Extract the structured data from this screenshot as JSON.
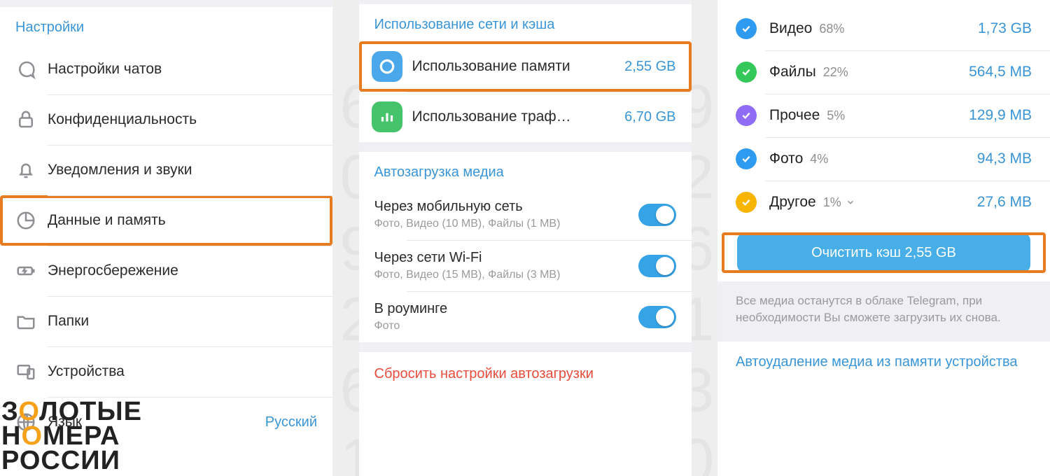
{
  "panel1": {
    "header": "Настройки",
    "items": [
      {
        "label": "Настройки чатов"
      },
      {
        "label": "Конфиденциальность"
      },
      {
        "label": "Уведомления и звуки"
      },
      {
        "label": "Данные и память",
        "highlighted": true
      },
      {
        "label": "Энергосбережение"
      },
      {
        "label": "Папки"
      },
      {
        "label": "Устройства"
      },
      {
        "label": "Язык",
        "value": "Русский"
      }
    ]
  },
  "panel2": {
    "section_usage": "Использование сети и кэша",
    "storage_label": "Использование памяти",
    "storage_value": "2,55 GB",
    "traffic_label": "Использование траф…",
    "traffic_value": "6,70 GB",
    "section_autoload": "Автозагрузка медиа",
    "autoload": [
      {
        "title": "Через мобильную сеть",
        "sub": "Фото, Видео (10 MB), Файлы (1 MB)"
      },
      {
        "title": "Через сети Wi-Fi",
        "sub": "Фото, Видео (15 MB), Файлы (3 MB)"
      },
      {
        "title": "В роуминге",
        "sub": "Фото"
      }
    ],
    "reset": "Сбросить настройки автозагрузки"
  },
  "panel3": {
    "categories": [
      {
        "name": "Видео",
        "pct": "68%",
        "size": "1,73 GB",
        "color": "#2f9bf0"
      },
      {
        "name": "Файлы",
        "pct": "22%",
        "size": "564,5 MB",
        "color": "#34c759"
      },
      {
        "name": "Прочее",
        "pct": "5%",
        "size": "129,9 MB",
        "color": "#8e6cf5"
      },
      {
        "name": "Фото",
        "pct": "4%",
        "size": "94,3 MB",
        "color": "#2f9bf0"
      },
      {
        "name": "Другое",
        "pct": "1%",
        "size": "27,6 MB",
        "color": "#f7b500",
        "expandable": true
      }
    ],
    "clear_button": "Очистить кэш 2,55 GB",
    "hint": "Все медиа останутся в облаке Telegram, при необходимости Вы сможете загрузить их снова.",
    "footer_link": "Автоудаление медиа из памяти устройства"
  },
  "watermark": {
    "l1a": "З",
    "l1b": "ЛОТЫЕ",
    "l2a": "Н",
    "l2b": "МЕРА",
    "l3": "РОССИИ"
  }
}
